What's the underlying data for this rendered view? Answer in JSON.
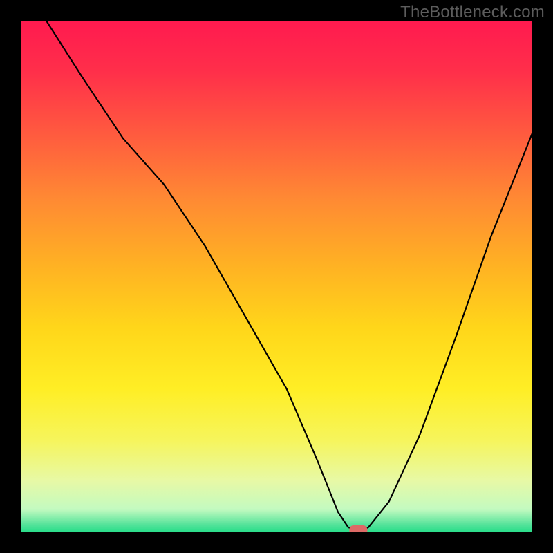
{
  "watermark": "TheBottleneck.com",
  "colors": {
    "background": "#000000",
    "gradient_stops": [
      {
        "offset": 0.0,
        "color": "#ff1a4f"
      },
      {
        "offset": 0.1,
        "color": "#ff2f4a"
      },
      {
        "offset": 0.22,
        "color": "#ff5a3f"
      },
      {
        "offset": 0.35,
        "color": "#ff8a33"
      },
      {
        "offset": 0.48,
        "color": "#ffb223"
      },
      {
        "offset": 0.6,
        "color": "#ffd61a"
      },
      {
        "offset": 0.72,
        "color": "#ffee25"
      },
      {
        "offset": 0.82,
        "color": "#f6f55c"
      },
      {
        "offset": 0.9,
        "color": "#e7f9a6"
      },
      {
        "offset": 0.955,
        "color": "#c3fac0"
      },
      {
        "offset": 0.985,
        "color": "#55e39a"
      },
      {
        "offset": 1.0,
        "color": "#27dd89"
      }
    ],
    "curve": "#000000",
    "marker": "#dd6a66"
  },
  "chart_data": {
    "type": "line",
    "title": "",
    "xlabel": "",
    "ylabel": "",
    "xlim": [
      0,
      100
    ],
    "ylim": [
      0,
      100
    ],
    "series": [
      {
        "name": "bottleneck-curve",
        "x": [
          5,
          12,
          20,
          28,
          36,
          44,
          52,
          58,
          62,
          64,
          66,
          68,
          72,
          78,
          85,
          92,
          100
        ],
        "y": [
          100,
          89,
          77,
          68,
          56,
          42,
          28,
          14,
          4,
          1,
          0,
          1,
          6,
          19,
          38,
          58,
          78
        ]
      }
    ],
    "annotations": [
      {
        "name": "optimal-marker",
        "x": 66,
        "y": 0
      }
    ]
  }
}
